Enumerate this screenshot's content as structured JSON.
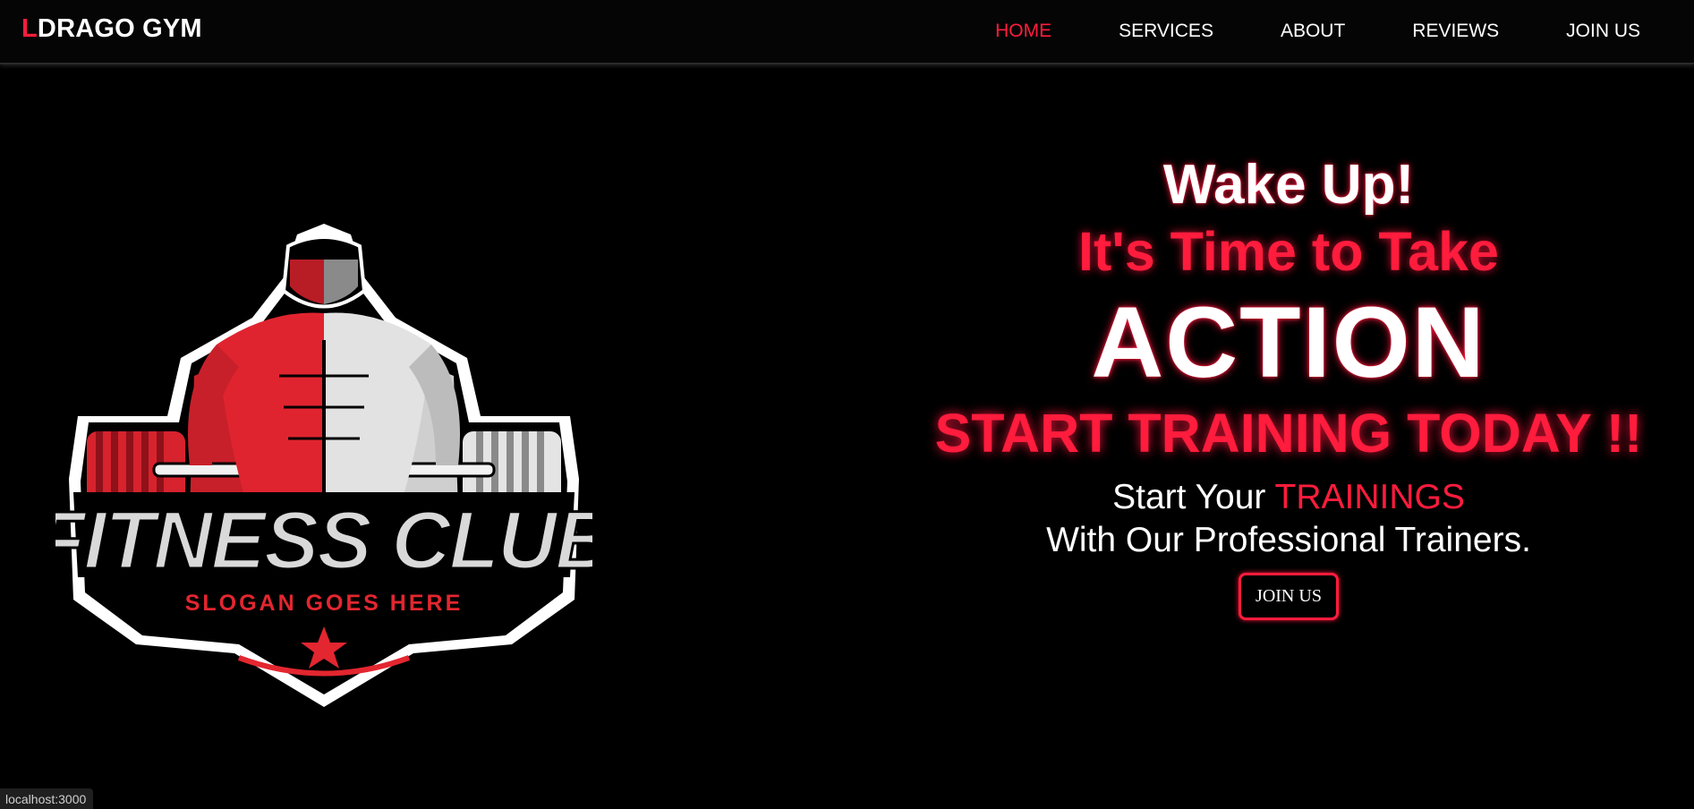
{
  "nav": {
    "brand_initial": "L",
    "brand_rest": "DRAGO GYM",
    "links": [
      "HOME",
      "SERVICES",
      "ABOUT",
      "REVIEWS",
      "JOIN US"
    ],
    "active": "HOME"
  },
  "logo": {
    "title": "FITNESS CLUB",
    "slogan": "SLOGAN GOES HERE",
    "icon": "weightlifter-emblem-icon"
  },
  "hero": {
    "line1": "Wake Up!",
    "line2": "It's Time to Take",
    "line3": "ACTION",
    "line4": "START TRAINING TODAY !!",
    "sub_prefix": "Start Your ",
    "sub_highlight": "TRAININGS",
    "sub_line2": "With Our Professional Trainers.",
    "cta_label": "JOIN US"
  },
  "status": {
    "url": "localhost:3000"
  },
  "colors": {
    "accent": "#ff1c3d",
    "background": "#000000",
    "text": "#ffffff"
  }
}
